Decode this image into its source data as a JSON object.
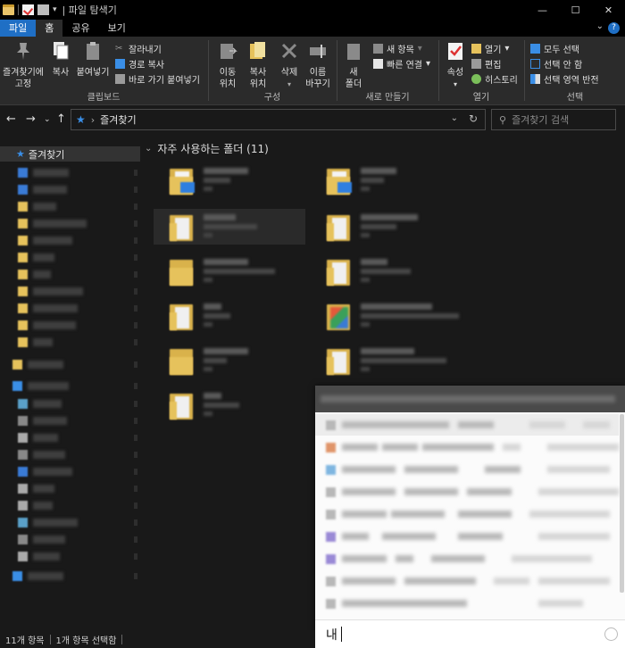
{
  "window": {
    "title": "| 파일 탐색기",
    "controls": [
      "—",
      "☐",
      "✕"
    ]
  },
  "tabs": [
    "파일",
    "홈",
    "공유",
    "보기"
  ],
  "ribbon": {
    "clipboard": {
      "label": "클립보드",
      "pin_label_1": "즐겨찾기에",
      "pin_label_2": "고정",
      "copy": "복사",
      "paste": "붙여넣기",
      "cut": "잘라내기",
      "copy_path": "경로 복사",
      "paste_shortcut": "바로 가기 붙여넣기"
    },
    "organize": {
      "label": "구성",
      "move_1": "이동",
      "move_2": "위치",
      "copyto_1": "복사",
      "copyto_2": "위치",
      "delete": "삭제",
      "rename_1": "이름",
      "rename_2": "바꾸기"
    },
    "new": {
      "label": "새로 만들기",
      "new_folder_1": "새",
      "new_folder_2": "폴더",
      "new_item": "새 항목",
      "easy_access": "빠른 연결"
    },
    "open": {
      "label": "열기",
      "properties": "속성",
      "open": "열기",
      "edit": "편집",
      "history": "히스토리"
    },
    "select": {
      "label": "선택",
      "select_all": "모두 선택",
      "select_none": "선택 안 함",
      "invert": "선택 영역 반전"
    }
  },
  "address": {
    "location": "즐겨찾기",
    "search_placeholder": "즐겨찾기 검색"
  },
  "nav": {
    "favorites": "즐겨찾기"
  },
  "content": {
    "section_title": "자주 사용하는 폴더 (11)"
  },
  "popup": {
    "input_text": "내"
  },
  "status": {
    "items": "11개 항목",
    "selected": "1개 항목 선택함"
  },
  "colors": {
    "accent": "#1f6fc5",
    "folder": "#e6c25c"
  }
}
